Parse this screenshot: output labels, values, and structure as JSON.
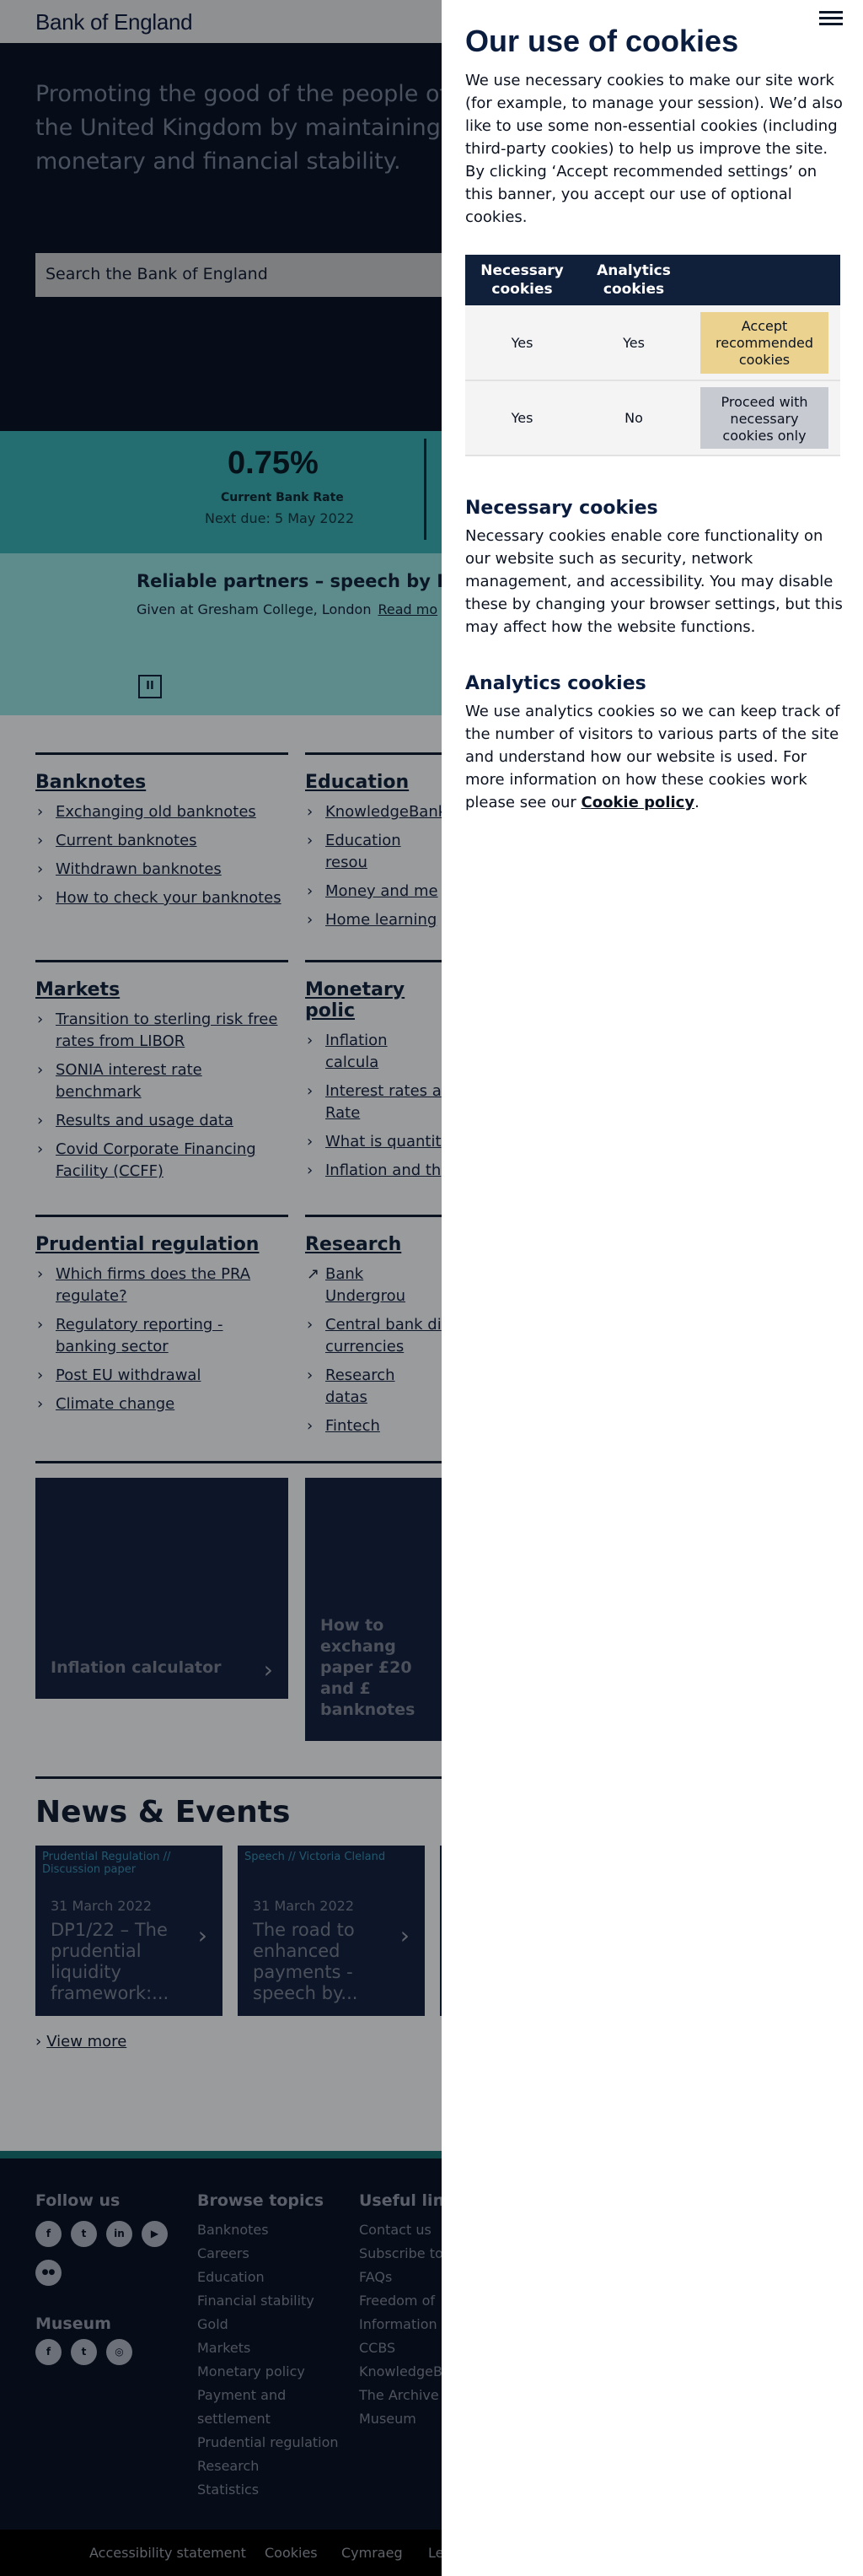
{
  "header": {
    "logo": "Bank of England"
  },
  "hero": {
    "tagline": "Promoting the good of the people of the United Kingdom by maintaining monetary and financial stability.",
    "search_placeholder": "Search the Bank of England"
  },
  "rate": {
    "value": "0.75%",
    "label": "Current Bank Rate",
    "next": "Next due: 5 May 2022"
  },
  "carousel": {
    "title": "Reliable partners – speech by Ben",
    "subtitle": "Given at Gresham College, London",
    "read_more": "Read mo",
    "pause": "II"
  },
  "sections": [
    {
      "title": "Banknotes",
      "items": [
        "Exchanging old banknotes",
        "Current banknotes",
        "Withdrawn banknotes",
        "How to check your banknotes"
      ]
    },
    {
      "title": "Education",
      "items": [
        "KnowledgeBank",
        "Education resou",
        "Money and me",
        "Home learning"
      ]
    },
    {
      "title": "Markets",
      "items": [
        "Transition to sterling risk free rates from LIBOR",
        "SONIA interest rate benchmark",
        "Results and usage data",
        "Covid Corporate Financing Facility (CCFF)"
      ]
    },
    {
      "title": "Monetary polic",
      "items": [
        "Inflation calcula",
        "Interest rates a Rate",
        "What is quantit",
        "Inflation and th"
      ]
    },
    {
      "title": "Prudential regulation",
      "items": [
        "Which firms does the PRA regulate?",
        "Regulatory reporting - banking sector",
        "Post EU withdrawal",
        "Climate change"
      ]
    },
    {
      "title": "Research",
      "items": [
        "Bank Undergrou",
        "Central bank di currencies",
        "Research datas",
        "Fintech"
      ]
    }
  ],
  "feature_cards": [
    {
      "title": "Inflation calculator"
    },
    {
      "title": "How to exchang paper £20 and £ banknotes"
    }
  ],
  "news": {
    "heading": "News & Events",
    "items": [
      {
        "category": "Prudential Regulation // Discussion paper",
        "date": "31 March 2022",
        "title": "DP1/22 – The prudential liquidity framework:..."
      },
      {
        "category": "Speech // Victoria Cleland",
        "date": "31 March 2022",
        "title": "The road to enhanced payments - speech by..."
      }
    ],
    "view_more": "View more"
  },
  "footer": {
    "follow_heading": "Follow us",
    "social": [
      "f",
      "t",
      "in",
      "▶",
      "●●"
    ],
    "museum_heading": "Museum",
    "museum_social": [
      "f",
      "t",
      "◎"
    ],
    "browse_heading": "Browse topics",
    "browse": [
      "Banknotes",
      "Careers",
      "Education",
      "Financial stability",
      "Gold",
      "Markets",
      "Monetary policy",
      "Payment and settlement",
      "Prudential regulation",
      "Research",
      "Statistics"
    ],
    "useful_heading": "Useful lin",
    "useful": [
      "Contact us",
      "Subscribe to",
      "FAQs",
      "Freedom of Information",
      "CCBS",
      "KnowledgeB",
      "The Archive",
      "Museum"
    ],
    "bottom": [
      "Accessibility statement",
      "Cookies",
      "Cymraeg",
      "Le"
    ]
  },
  "cookies": {
    "title": "Our use of cookies",
    "intro": "We use necessary cookies to make our site work (for example, to manage your session). We’d also like to use some non-essential cookies (including third-party cookies) to help us improve the site. By clicking ‘Accept recommended settings’ on this banner, you accept our use of optional cookies.",
    "table": {
      "headers": [
        "Necessary cookies",
        "Analytics cookies"
      ],
      "rows": [
        {
          "necessary": "Yes",
          "analytics": "Yes",
          "button": "Accept recommended cookies"
        },
        {
          "necessary": "Yes",
          "analytics": "No",
          "button": "Proceed with necessary cookies only"
        }
      ]
    },
    "necessary_heading": "Necessary cookies",
    "necessary_text": "Necessary cookies enable core functionality on our website such as security, network management, and accessibility. You may disable these by changing your browser settings, but this may affect how the website functions.",
    "analytics_heading": "Analytics cookies",
    "analytics_text_before": "We use analytics cookies so we can keep track of the number of visitors to various parts of the site and understand how our website is used. For more information on how these cookies work please see our",
    "cookie_policy_link": "Cookie policy",
    "analytics_text_after": "."
  },
  "colors": {
    "panel_header": "#11203a",
    "accept_button": "#ebd38f",
    "necessary_button": "#c8cad1",
    "overlay": "#9a9b9d"
  }
}
